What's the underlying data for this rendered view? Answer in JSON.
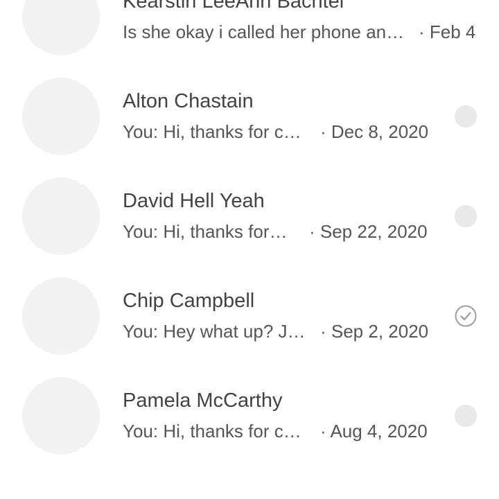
{
  "conversations": [
    {
      "name": "Kearstin LeeAnn Bachtel",
      "snippet": "Is she okay i called her phone an…",
      "date": "· Feb 4",
      "status": "none",
      "status_icon": ""
    },
    {
      "name": "Alton Chastain",
      "snippet": "You: Hi, thanks for c…",
      "date": "· Dec 8, 2020",
      "status": "dot",
      "status_icon": "unread-dot-icon"
    },
    {
      "name": "David Hell Yeah",
      "snippet": "You: Hi, thanks for…",
      "date": "· Sep 22, 2020",
      "status": "dot",
      "status_icon": "unread-dot-icon"
    },
    {
      "name": "Chip Campbell",
      "snippet": "You: Hey what up? J…",
      "date": "· Sep 2, 2020",
      "status": "check",
      "status_icon": "sent-check-icon"
    },
    {
      "name": "Pamela McCarthy",
      "snippet": "You: Hi, thanks for c…",
      "date": "· Aug 4, 2020",
      "status": "dot",
      "status_icon": "unread-dot-icon"
    }
  ],
  "colors": {
    "avatar_placeholder": "#f2f2f2",
    "status_dot": "#e9e9e9",
    "check_ring": "#9e9e9e"
  }
}
